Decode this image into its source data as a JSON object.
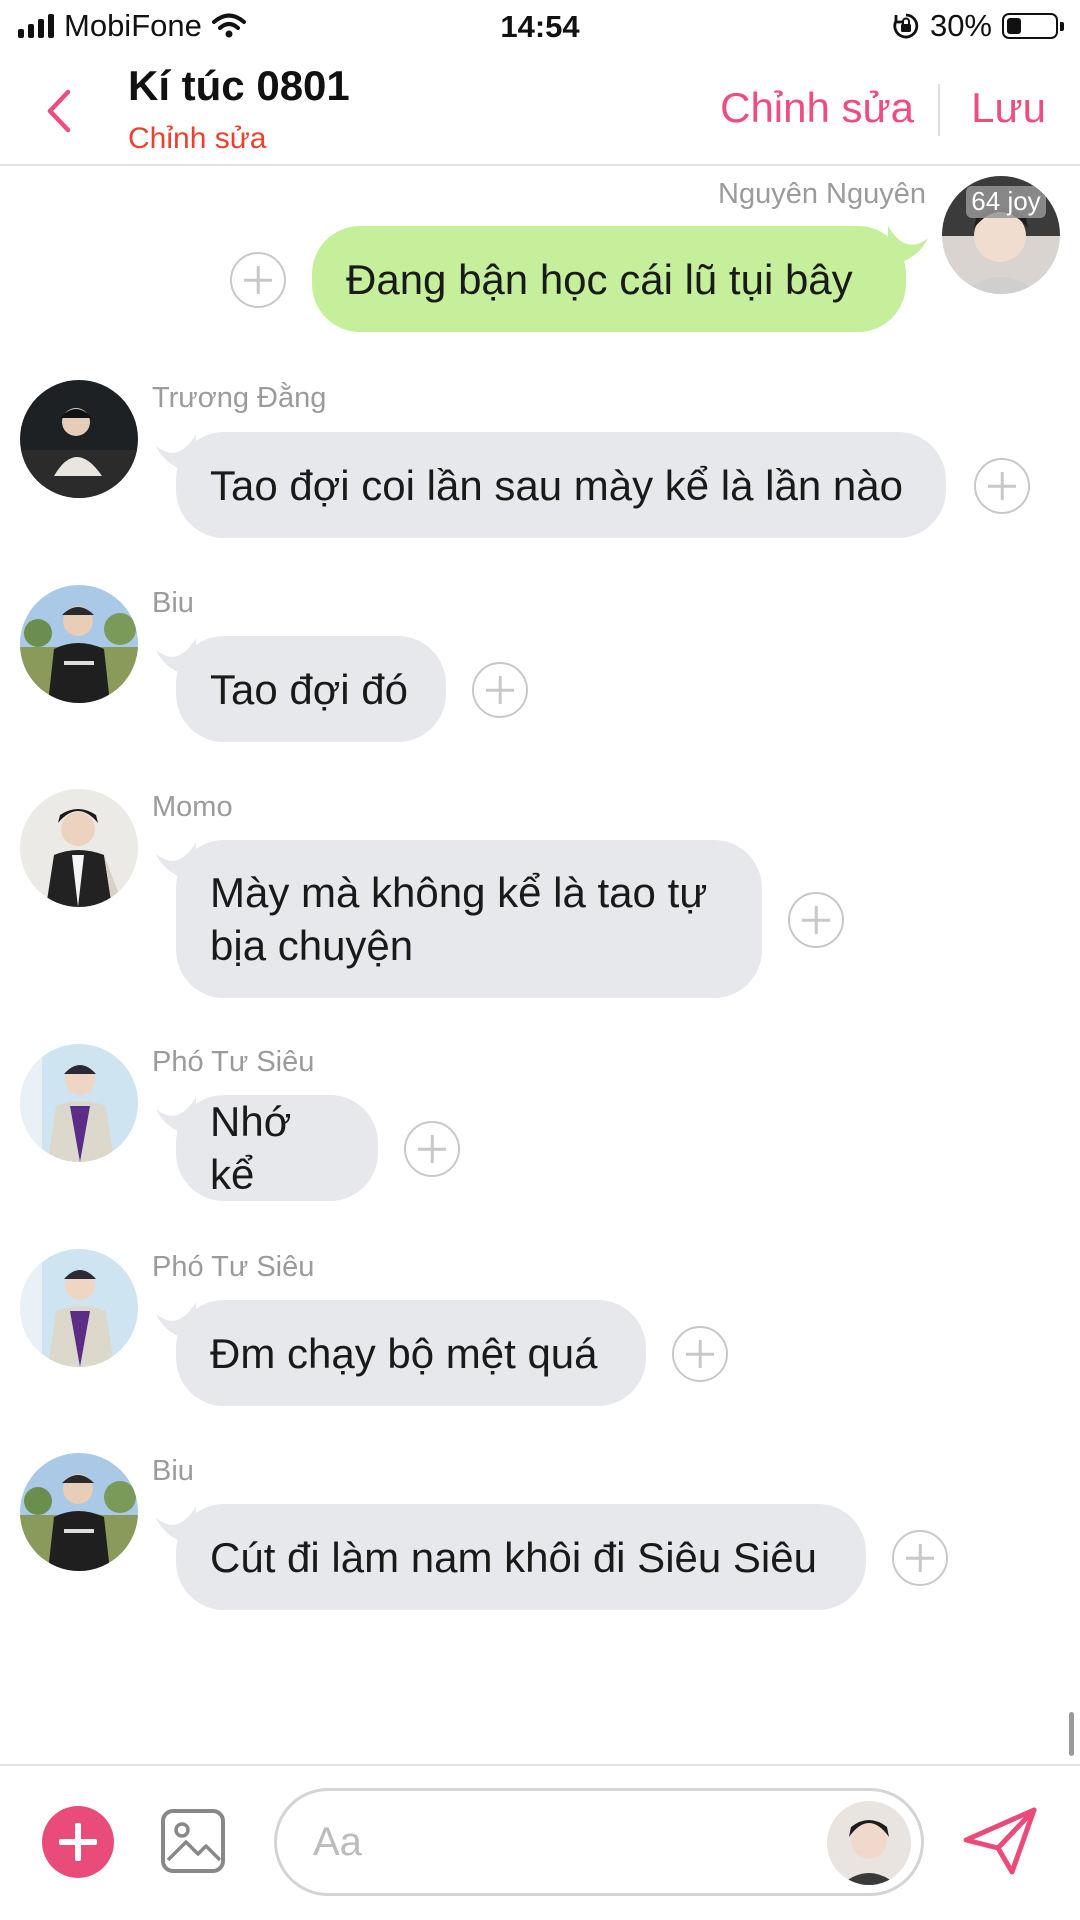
{
  "status_bar": {
    "carrier": "MobiFone",
    "time": "14:54",
    "battery_percent": "30%",
    "battery_level": 0.3,
    "icons": [
      "signal-icon",
      "wifi-icon",
      "orientation-lock-icon",
      "battery-icon"
    ]
  },
  "header": {
    "title": "Kí túc 0801",
    "subtitle": "Chỉnh sửa",
    "edit_label": "Chỉnh sửa",
    "save_label": "Lưu",
    "accent_color": "#ee4e7d",
    "subtitle_color": "#e8432e"
  },
  "messages": [
    {
      "sender": "Nguyên Nguyên",
      "text": "Đang bận học cái lũ tụi bây",
      "direction": "outgoing",
      "avatar_badge": "64 joy"
    },
    {
      "sender": "Trương Đằng",
      "text": "Tao đợi coi lần sau mày kể là lần nào",
      "direction": "incoming"
    },
    {
      "sender": "Biu",
      "text": "Tao đợi đó",
      "direction": "incoming"
    },
    {
      "sender": "Momo",
      "text": "Mày mà không kể là tao tự bịa chuyện",
      "direction": "incoming"
    },
    {
      "sender": "Phó Tư Siêu",
      "text": "Nhớ kể",
      "direction": "incoming"
    },
    {
      "sender": "Phó Tư Siêu",
      "text": "Đm chạy bộ mệt quá",
      "direction": "incoming"
    },
    {
      "sender": "Biu",
      "text": "Cút đi làm nam khôi đi Siêu Siêu",
      "direction": "incoming"
    }
  ],
  "composer": {
    "placeholder": "Aa",
    "fab_color": "#ea4c79"
  },
  "colors": {
    "incoming_bubble": "#e6e8eb",
    "outgoing_bubble": "#c6ef9b"
  }
}
